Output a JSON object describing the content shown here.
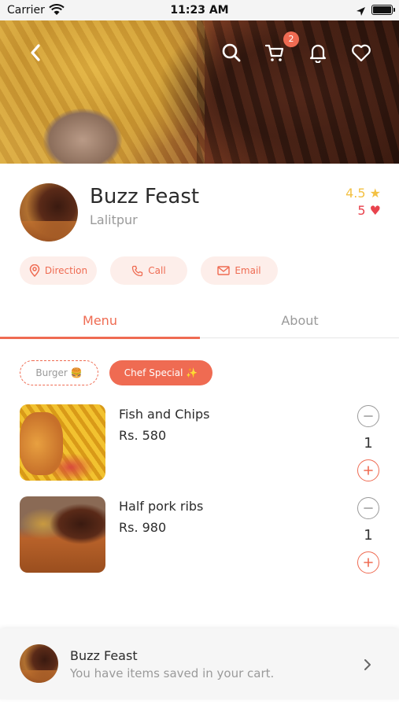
{
  "status_bar": {
    "carrier": "Carrier",
    "time": "11:23 AM"
  },
  "header": {
    "cart_count": "2",
    "icons": [
      "back-icon",
      "search-icon",
      "cart-icon",
      "bell-icon",
      "heart-icon"
    ]
  },
  "restaurant": {
    "name": "Buzz Feast",
    "location": "Lalitpur",
    "rating": "4.5 ★",
    "likes": "5 ♥"
  },
  "actions": {
    "direction": "Direction",
    "call": "Call",
    "email": "Email"
  },
  "tabs": {
    "menu": "Menu",
    "about": "About"
  },
  "categories": {
    "burger": "Burger 🍔",
    "chef_special": "Chef Special ✨"
  },
  "menu_items": [
    {
      "name": "Fish and Chips",
      "price": "Rs. 580",
      "quantity": "1"
    },
    {
      "name": "Half pork ribs",
      "price": "Rs. 980",
      "quantity": "1"
    }
  ],
  "cart_bar": {
    "title": "Buzz Feast",
    "subtitle": "You have items saved in your cart."
  },
  "colors": {
    "accent": "#ef6b52",
    "accent_light": "#fdeeea",
    "rating": "#f3c143",
    "likes": "#e8434d",
    "muted_text": "#9a9a9a"
  }
}
